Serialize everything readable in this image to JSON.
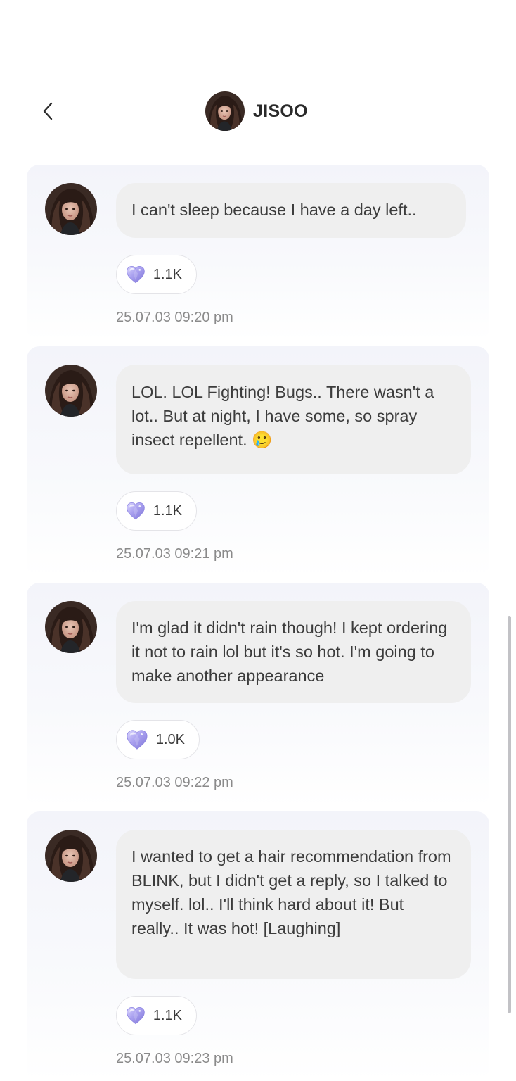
{
  "header": {
    "title": "JISOO"
  },
  "messages": [
    {
      "text": "I can't sleep because I have a day left..",
      "reaction_count": "1.1K",
      "timestamp": "25.07.03 09:20 pm"
    },
    {
      "text": "LOL. LOL Fighting! Bugs.. There wasn't a lot.. But at night, I have some, so spray insect repellent. 🥲",
      "reaction_count": "1.1K",
      "timestamp": "25.07.03 09:21 pm"
    },
    {
      "text": "I'm glad it didn't rain though! I kept ordering it not to rain lol but it's so hot. I'm going to make another appearance",
      "reaction_count": "1.0K",
      "timestamp": "25.07.03 09:22 pm"
    },
    {
      "text": "I wanted to get a hair recommendation from BLINK, but I didn't get a reply, so I talked to myself. lol.. I'll think hard about it! But really.. It was hot! [Laughing]",
      "reaction_count": "1.1K",
      "timestamp": "25.07.03 09:23 pm"
    }
  ],
  "icons": {
    "back": "chevron-left-icon",
    "reaction": "crystal-heart-icon",
    "avatar": "profile-avatar"
  },
  "colors": {
    "card_background": "#f3f4fa",
    "bubble_background": "#efefef",
    "heart": "#b8b2f0",
    "timestamp": "#8a8a8a"
  }
}
